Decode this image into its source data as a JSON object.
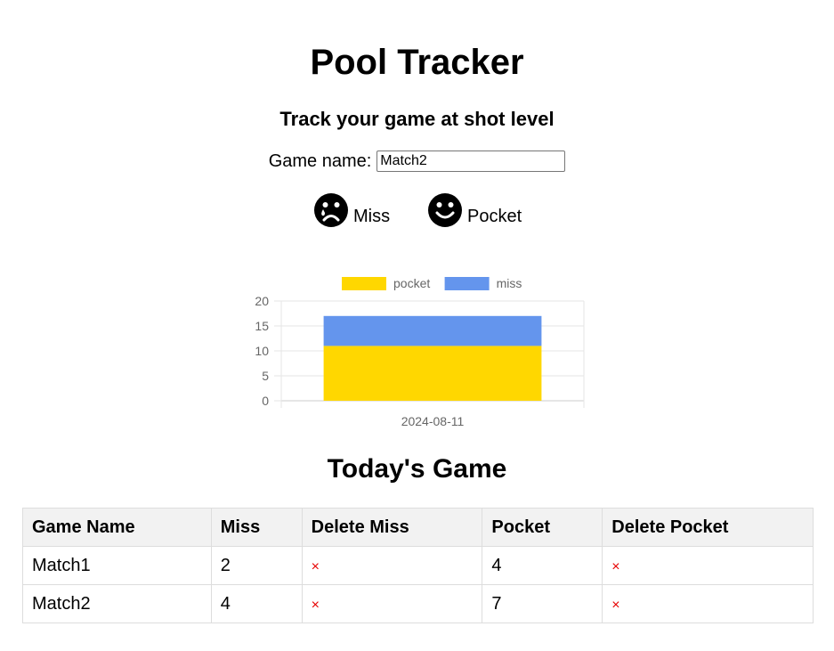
{
  "header": {
    "title": "Pool Tracker",
    "subtitle": "Track your game at shot level"
  },
  "game_form": {
    "label": "Game name:",
    "value": "Match2"
  },
  "buttons": {
    "miss_label": "Miss",
    "miss_icon": "crying-face-icon",
    "pocket_label": "Pocket",
    "pocket_icon": "smiling-face-icon"
  },
  "chart_data": {
    "type": "bar",
    "stacked": true,
    "categories": [
      "2024-08-11"
    ],
    "series": [
      {
        "name": "pocket",
        "values": [
          11
        ],
        "color": "#FFD700"
      },
      {
        "name": "miss",
        "values": [
          6
        ],
        "color": "#6495ED"
      }
    ],
    "ylim": [
      0,
      20
    ],
    "yticks": [
      0,
      5,
      10,
      15,
      20
    ],
    "legend": "top",
    "grid": true
  },
  "section": {
    "title": "Today's Game"
  },
  "table": {
    "headers": [
      "Game Name",
      "Miss",
      "Delete Miss",
      "Pocket",
      "Delete Pocket"
    ],
    "rows": [
      {
        "name": "Match1",
        "miss": "2",
        "delete_miss": "×",
        "pocket": "4",
        "delete_pocket": "×"
      },
      {
        "name": "Match2",
        "miss": "4",
        "delete_miss": "×",
        "pocket": "7",
        "delete_pocket": "×"
      }
    ]
  }
}
